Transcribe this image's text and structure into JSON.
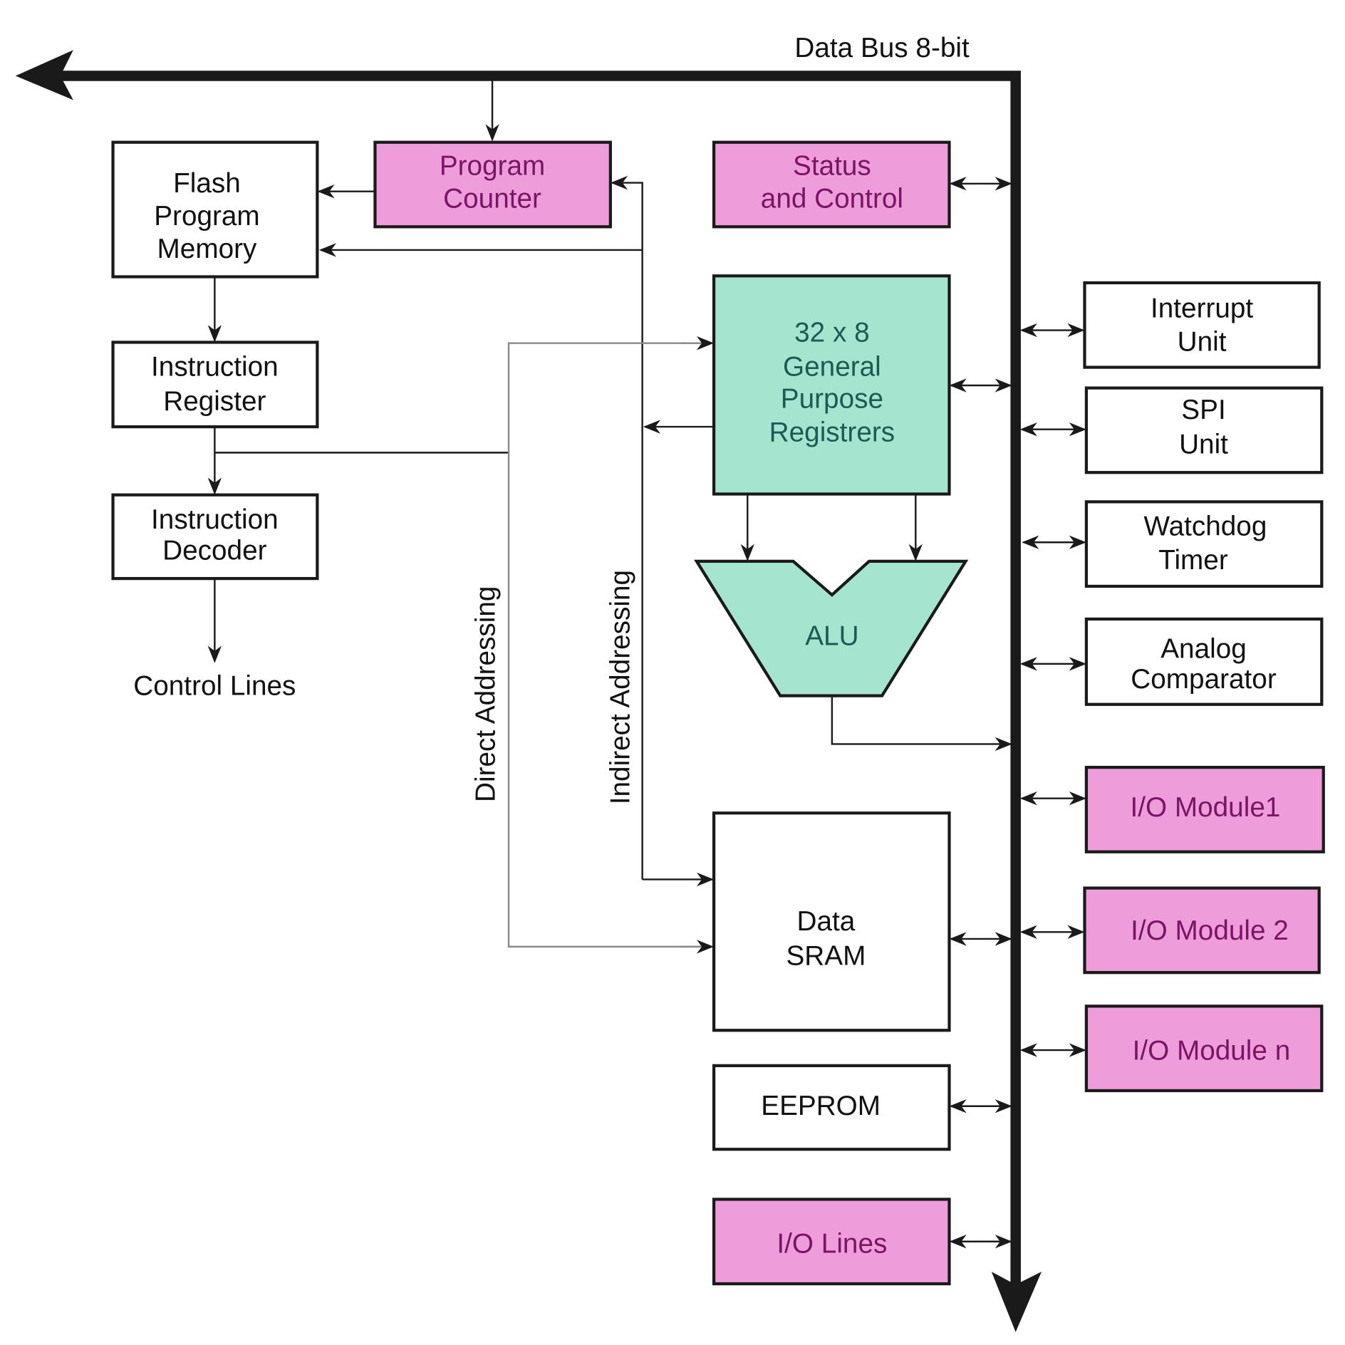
{
  "bus": {
    "label": "Data Bus 8-bit"
  },
  "colors": {
    "pink_fill": "#ee9cda",
    "pink_text": "#7a1466",
    "teal_fill": "#a5e5d0",
    "teal_text": "#1d5a55",
    "outline": "#1a1a1a",
    "address_line": "#8a8a8a"
  },
  "blocks": {
    "flash": [
      "Flash",
      "Program",
      "Memory"
    ],
    "program_counter": [
      "Program",
      "Counter"
    ],
    "status_control": [
      "Status",
      "and Control"
    ],
    "instruction_register": [
      "Instruction",
      "Register"
    ],
    "instruction_decoder": [
      "Instruction",
      "Decoder"
    ],
    "control_lines": "Control Lines",
    "gpr": [
      "32 x 8",
      "General",
      "Purpose",
      "Registrers"
    ],
    "alu": "ALU",
    "sram": [
      "Data",
      "SRAM"
    ],
    "eeprom": "EEPROM",
    "io_lines": "I/O Lines",
    "interrupt": [
      "Interrupt",
      "Unit"
    ],
    "spi": [
      "SPI",
      "Unit"
    ],
    "watchdog": [
      "Watchdog",
      "Timer"
    ],
    "analog": [
      "Analog",
      "Comparator"
    ],
    "io_module1": "I/O Module1",
    "io_module2": "I/O Module 2",
    "io_modulen": "I/O Module n"
  },
  "labels": {
    "direct": "Direct Addressing",
    "indirect": "Indirect Addressing"
  }
}
